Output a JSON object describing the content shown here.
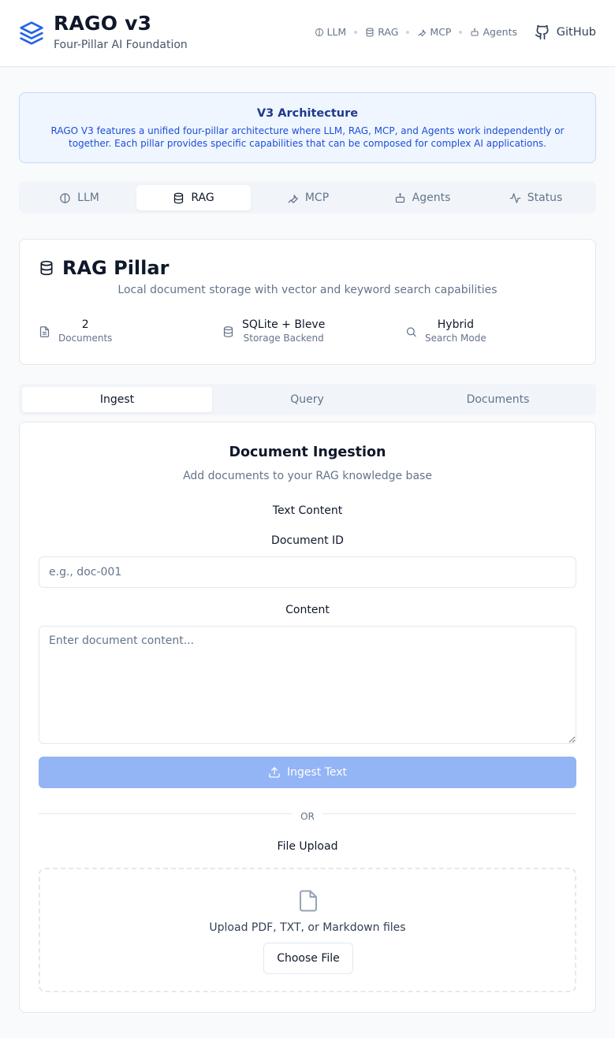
{
  "header": {
    "title": "RAGO v3",
    "subtitle": "Four-Pillar AI Foundation",
    "nav": [
      "LLM",
      "RAG",
      "MCP",
      "Agents"
    ],
    "github_label": "GitHub"
  },
  "architecture": {
    "title": "V3 Architecture",
    "description": "RAGO V3 features a unified four-pillar architecture where LLM, RAG, MCP, and Agents work independently or together. Each pillar provides specific capabilities that can be composed for complex AI applications."
  },
  "pillar_tabs": {
    "items": [
      "LLM",
      "RAG",
      "MCP",
      "Agents",
      "Status"
    ],
    "active": "RAG"
  },
  "rag": {
    "title": "RAG Pillar",
    "subtitle": "Local document storage with vector and keyword search capabilities",
    "stats": [
      {
        "value": "2",
        "label": "Documents",
        "icon": "file-text-icon"
      },
      {
        "value": "SQLite + Bleve",
        "label": "Storage Backend",
        "icon": "database-icon"
      },
      {
        "value": "Hybrid",
        "label": "Search Mode",
        "icon": "search-icon"
      }
    ]
  },
  "sub_tabs": {
    "items": [
      "Ingest",
      "Query",
      "Documents"
    ],
    "active": "Ingest"
  },
  "ingestion": {
    "title": "Document Ingestion",
    "subtitle": "Add documents to your RAG knowledge base",
    "text_section_label": "Text Content",
    "doc_id_label": "Document ID",
    "doc_id_placeholder": "e.g., doc-001",
    "doc_id_value": "",
    "content_label": "Content",
    "content_placeholder": "Enter document content...",
    "content_value": "",
    "ingest_button": "Ingest Text",
    "or_label": "OR",
    "file_section_label": "File Upload",
    "drop_text": "Upload PDF, TXT, or Markdown files",
    "choose_button": "Choose File"
  },
  "colors": {
    "accent": "#2563eb",
    "button_disabled": "#93b4f5",
    "banner_bg": "#eff6ff",
    "banner_title": "#1e3a8a"
  }
}
